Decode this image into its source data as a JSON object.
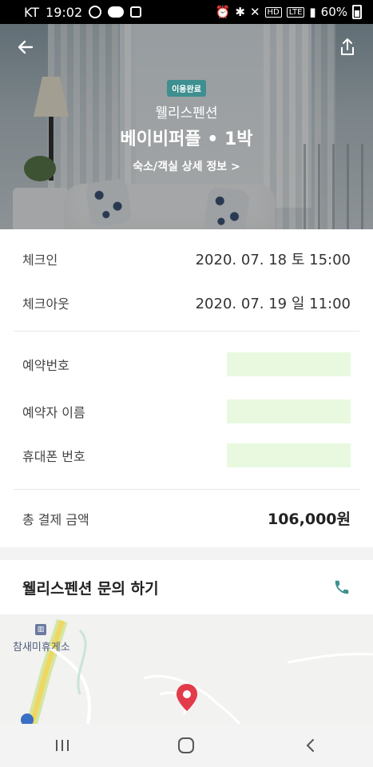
{
  "status_bar": {
    "carrier": "KT",
    "time": "19:02",
    "network": "LTE",
    "hd": "HD",
    "battery": "60%"
  },
  "hero": {
    "badge": "이용완료",
    "property_name": "웰리스펜션",
    "room_info": "베이비퍼플 • 1박",
    "detail_link": "숙소/객실 상세 정보 >"
  },
  "booking": {
    "checkin_label": "체크인",
    "checkin_value": "2020. 07. 18 토 15:00",
    "checkout_label": "체크아웃",
    "checkout_value": "2020. 07. 19 일 11:00",
    "reservation_no_label": "예약번호",
    "reserver_name_label": "예약자 이름",
    "phone_label": "휴대폰 번호",
    "total_label": "총 결제 금액",
    "total_value": "106,000원"
  },
  "inquiry": {
    "title": "웰리스펜션 문의 하기",
    "icon": "phone-icon"
  },
  "map": {
    "poi_label": "참새미휴게소"
  },
  "colors": {
    "accent": "#3e8f90",
    "masked": "#e8f9df",
    "pin": "#e23b4a"
  }
}
